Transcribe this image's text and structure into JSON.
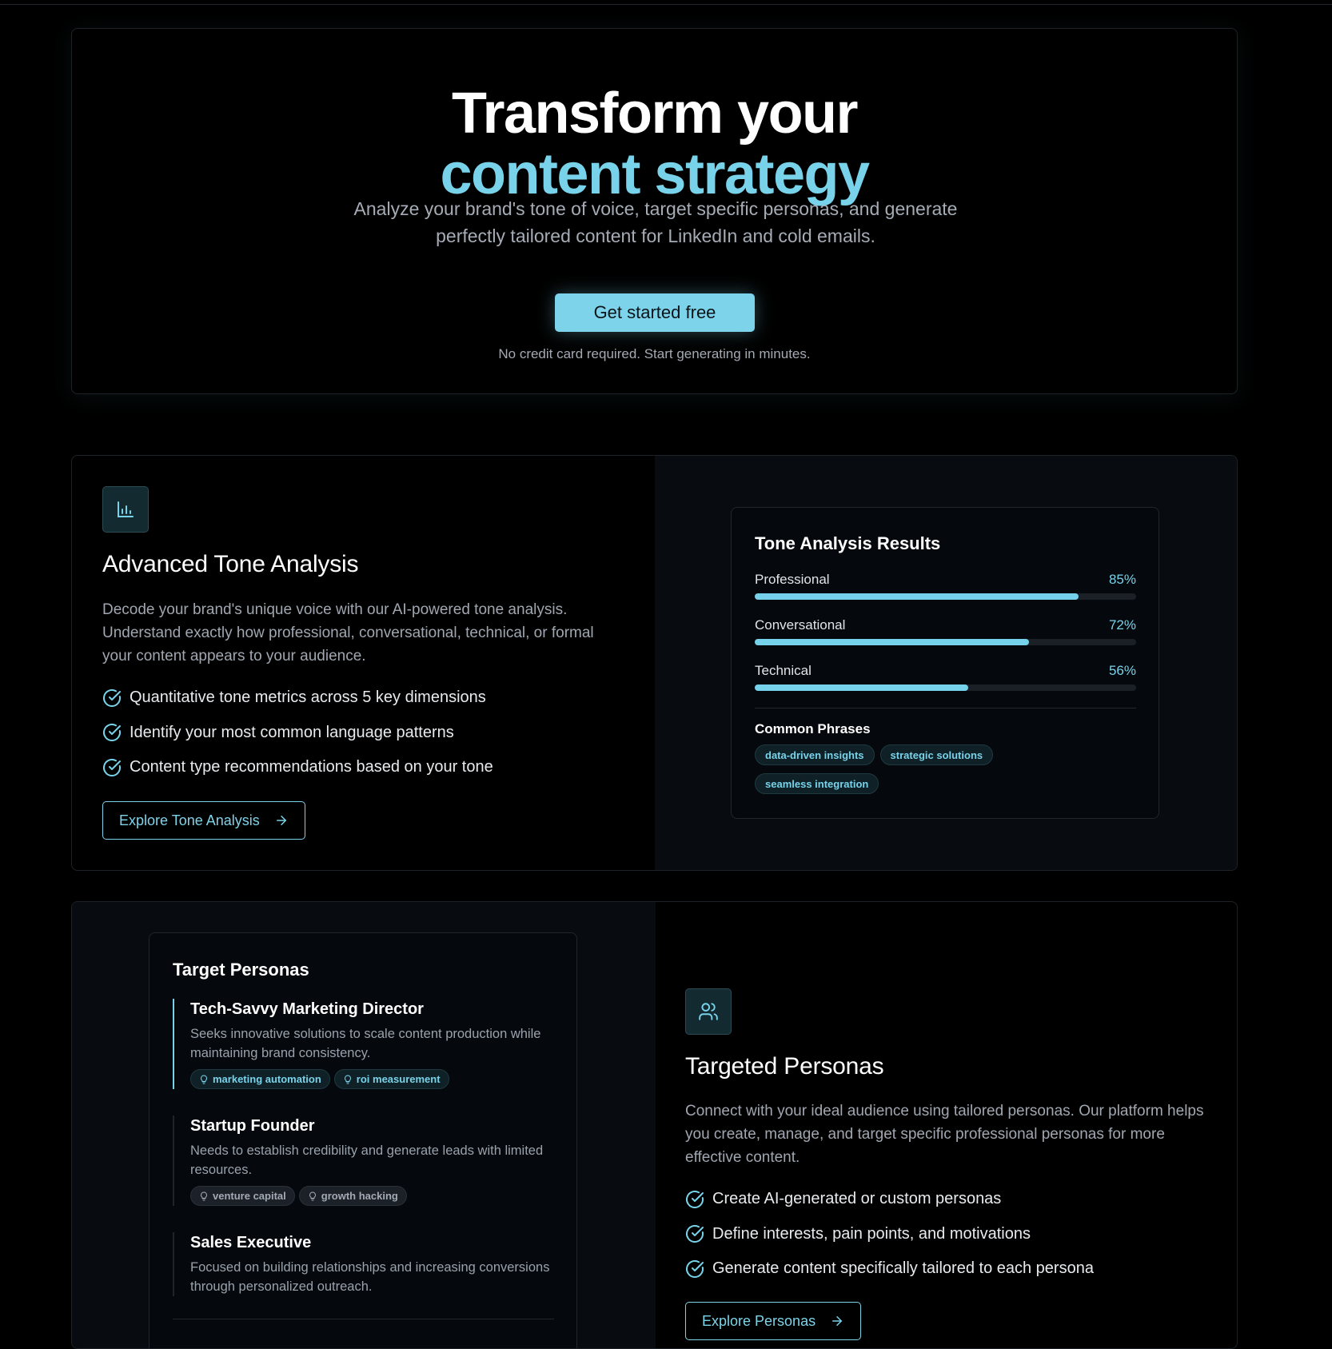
{
  "hero": {
    "title_line1": "Transform your",
    "title_line2": "content strategy",
    "subtitle": "Analyze your brand's tone of voice, target specific personas, and generate perfectly tailored content for LinkedIn and cold emails.",
    "cta_label": "Get started free",
    "note": "No credit card required. Start generating in minutes."
  },
  "tone_feature": {
    "icon": "bar-chart-icon",
    "title": "Advanced Tone Analysis",
    "description": "Decode your brand's unique voice with our AI-powered tone analysis. Understand exactly how professional, conversational, technical, or formal your content appears to your audience.",
    "bullets": [
      "Quantitative tone metrics across 5 key dimensions",
      "Identify your most common language patterns",
      "Content type recommendations based on your tone"
    ],
    "button_label": "Explore Tone Analysis"
  },
  "tone_results": {
    "title": "Tone Analysis Results",
    "metrics": [
      {
        "label": "Professional",
        "value": 85,
        "display": "85%"
      },
      {
        "label": "Conversational",
        "value": 72,
        "display": "72%"
      },
      {
        "label": "Technical",
        "value": 56,
        "display": "56%"
      }
    ],
    "phrases_title": "Common Phrases",
    "phrases": [
      "data-driven insights",
      "strategic solutions",
      "seamless integration"
    ]
  },
  "personas_panel": {
    "title": "Target Personas",
    "personas": [
      {
        "name": "Tech-Savvy Marketing Director",
        "description": "Seeks innovative solutions to scale content production while maintaining brand consistency.",
        "tags": [
          "marketing automation",
          "roi measurement"
        ],
        "active": true
      },
      {
        "name": "Startup Founder",
        "description": "Needs to establish credibility and generate leads with limited resources.",
        "tags": [
          "venture capital",
          "growth hacking"
        ],
        "active": false
      },
      {
        "name": "Sales Executive",
        "description": "Focused on building relationships and increasing conversions through personalized outreach.",
        "tags": [],
        "active": false
      }
    ]
  },
  "persona_feature": {
    "icon": "users-icon",
    "title": "Targeted Personas",
    "description": "Connect with your ideal audience using tailored personas. Our platform helps you create, manage, and target specific professional personas for more effective content.",
    "bullets": [
      "Create AI-generated or custom personas",
      "Define interests, pain points, and motivations",
      "Generate content specifically tailored to each persona"
    ],
    "button_label": "Explore Personas"
  },
  "colors": {
    "accent": "#78d3ea",
    "background": "#000000",
    "panel": "#05080c",
    "muted_text": "#a0a7b1"
  }
}
